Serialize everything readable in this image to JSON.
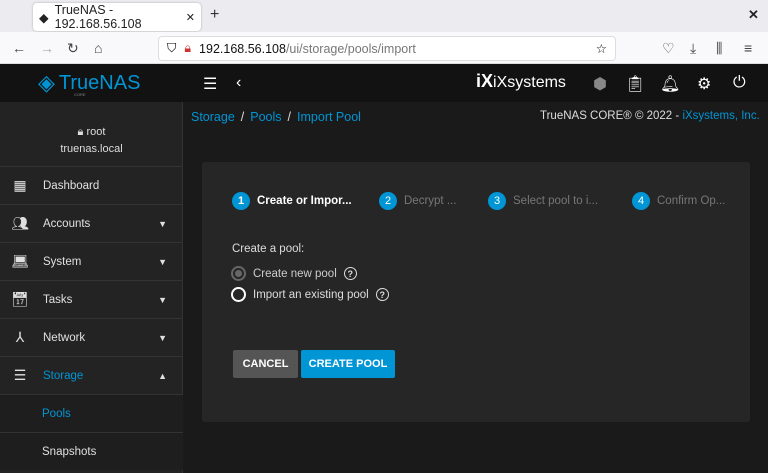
{
  "browser": {
    "tab_title": "TrueNAS - 192.168.56.108",
    "url_host": "192.168.56.108",
    "url_path": "/ui/storage/pools/import"
  },
  "app": {
    "logo": "TrueNAS",
    "logo_sub": "CORE",
    "vendor": "iXsystems"
  },
  "user": {
    "name": "root",
    "host": "truenas.local"
  },
  "sidebar": {
    "items": [
      {
        "label": "Dashboard",
        "icon": "dashboard-icon"
      },
      {
        "label": "Accounts",
        "icon": "accounts-icon"
      },
      {
        "label": "System",
        "icon": "laptop-icon"
      },
      {
        "label": "Tasks",
        "icon": "calendar-icon"
      },
      {
        "label": "Network",
        "icon": "network-icon"
      },
      {
        "label": "Storage",
        "icon": "storage-icon"
      }
    ],
    "sub_items": [
      "Pools",
      "Snapshots"
    ]
  },
  "breadcrumb": [
    "Storage",
    "Pools",
    "Import Pool"
  ],
  "copyright": {
    "text": "TrueNAS CORE® © 2022 - ",
    "link": "iXsystems, Inc."
  },
  "wizard": {
    "steps": [
      {
        "n": "1",
        "label": "Create or Impor..."
      },
      {
        "n": "2",
        "label": "Decrypt ..."
      },
      {
        "n": "3",
        "label": "Select pool to i..."
      },
      {
        "n": "4",
        "label": "Confirm Op..."
      }
    ],
    "question": "Create a pool:",
    "options": [
      "Create new pool",
      "Import an existing pool"
    ],
    "help": "?",
    "cancel": "CANCEL",
    "create": "CREATE POOL"
  },
  "colors": {
    "accent": "#0095d5"
  }
}
